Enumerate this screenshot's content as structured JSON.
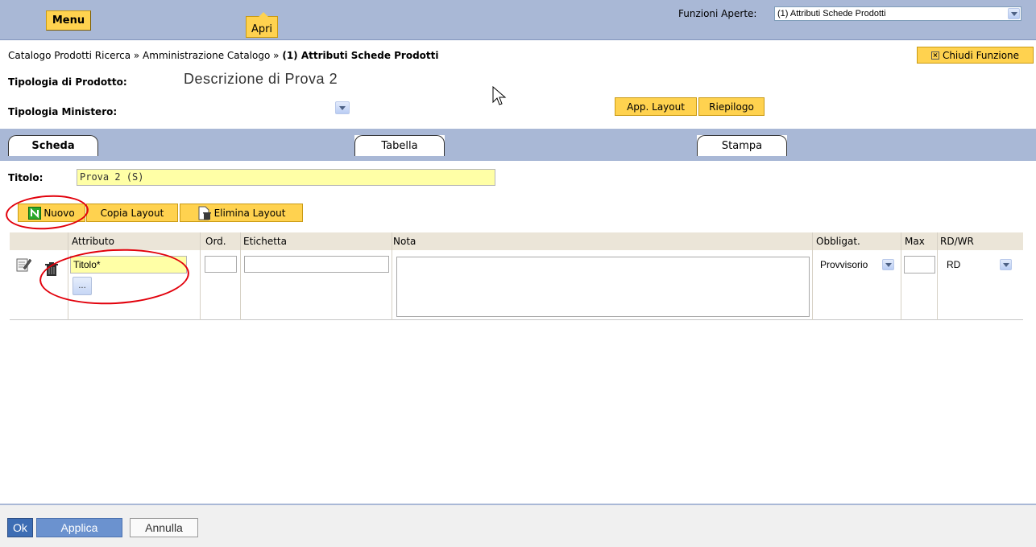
{
  "topbar": {
    "menu_label": "Menu",
    "apri_label": "Apri",
    "funzioni_label": "Funzioni Aperte:",
    "funzioni_selected": "(1) Attributi Schede Prodotti"
  },
  "breadcrumb": {
    "path": "Catalogo Prodotti Ricerca » Amministrazione Catalogo »",
    "current": "(1) Attributi Schede Prodotti"
  },
  "chiudi_label": "Chiudi Funzione",
  "tipologia_prodotto": {
    "label": "Tipologia di Prodotto:",
    "value": "Descrizione di Prova 2"
  },
  "tipologia_ministero": {
    "label": "Tipologia Ministero:"
  },
  "buttons": {
    "app_layout": "App. Layout",
    "riepilogo": "Riepilogo",
    "nuovo": "Nuovo",
    "copia_layout": "Copia Layout",
    "elimina_layout": "Elimina Layout"
  },
  "tabs": [
    {
      "label": "Scheda",
      "active": true
    },
    {
      "label": "Tabella",
      "active": false
    },
    {
      "label": "Stampa",
      "active": false
    }
  ],
  "titolo": {
    "label": "Titolo:",
    "value": "Prova 2 (S)"
  },
  "table": {
    "headers": [
      "Attributo",
      "Ord.",
      "Etichetta",
      "Nota",
      "Obbligat.",
      "Max",
      "RD/WR"
    ],
    "row": {
      "attributo": "Titolo*",
      "dots": "...",
      "obbligat": "Provvisorio",
      "rdwr": "RD"
    }
  },
  "footer": {
    "ok": "Ok",
    "applica": "Applica",
    "annulla": "Annulla"
  },
  "colors": {
    "accent_bar": "#a9b8d6",
    "button_yellow": "#ffd24f",
    "input_yellow": "#ffffa6",
    "annotation_red": "#e2000b",
    "primary_blue": "#3d6db4"
  }
}
